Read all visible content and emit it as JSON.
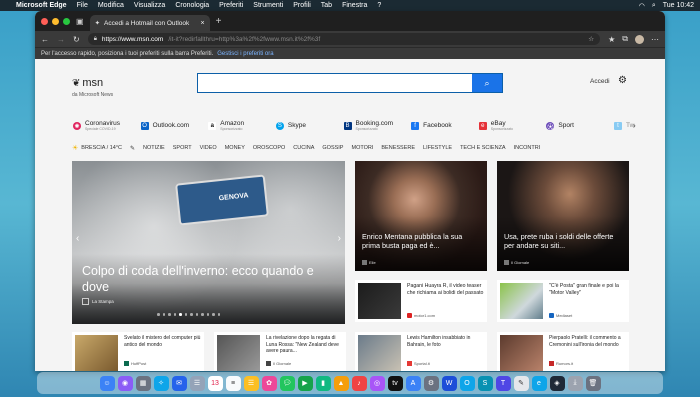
{
  "menubar": {
    "app": "Microsoft Edge",
    "items": [
      "File",
      "Modifica",
      "Visualizza",
      "Cronologia",
      "Preferiti",
      "Strumenti",
      "Profili",
      "Tab",
      "Finestra",
      "?"
    ],
    "clock": "Tue 10:42"
  },
  "browser": {
    "tab_title": "Accedi a Hotmail con Outlook",
    "url_host": "https://www.msn.com",
    "url_path": "/it-it?redirfallthru=http%3a%2f%2fwww.msn.it%2f%3f",
    "favbar_text": "Per l'accesso rapido, posiziona i tuoi preferiti sulla barra Preferiti.",
    "favbar_link": "Gestisci i preferiti ora"
  },
  "msn": {
    "logo": "msn",
    "logo_sub": "da Microsoft News",
    "search_placeholder": "",
    "signin": "Accedi"
  },
  "quicklinks": [
    {
      "label": "Coronavirus",
      "sub": "Speciale COVID-19",
      "icon": "virus-icon",
      "color": "#e0245e"
    },
    {
      "label": "Outlook.com",
      "sub": "",
      "icon": "outlook-icon",
      "color": "#0a64c8"
    },
    {
      "label": "Amazon",
      "sub": "Sponsorizzato",
      "icon": "amazon-icon",
      "color": "#111111"
    },
    {
      "label": "Skype",
      "sub": "",
      "icon": "skype-icon",
      "color": "#00a2ed"
    },
    {
      "label": "Booking.com",
      "sub": "Sponsorizzato",
      "icon": "booking-icon",
      "color": "#003580"
    },
    {
      "label": "Facebook",
      "sub": "",
      "icon": "facebook-icon",
      "color": "#1877f2"
    },
    {
      "label": "eBay",
      "sub": "Sponsorizzato",
      "icon": "ebay-icon",
      "color": "#e53238"
    },
    {
      "label": "Sport",
      "sub": "",
      "icon": "sport-icon",
      "color": "#6b4bb8"
    },
    {
      "label": "Tw",
      "sub": "",
      "icon": "twitter-icon",
      "color": "#1da1f2"
    }
  ],
  "categories": {
    "weather": "BRESCIA / 14°C",
    "items": [
      "NOTIZIE",
      "SPORT",
      "VIDEO",
      "MONEY",
      "OROSCOPO",
      "CUCINA",
      "GOSSIP",
      "MOTORI",
      "BENESSERE",
      "LIFESTYLE",
      "TECH E SCIENZA",
      "INCONTRI"
    ]
  },
  "hero": {
    "title": "Colpo di coda dell'inverno: ecco quando e dove",
    "source": "La Stampa",
    "sign": "GENOVA"
  },
  "big_cards": [
    {
      "title": "Enrico Mentana pubblica la sua prima busta paga ed è...",
      "source": "Elle"
    },
    {
      "title": "Usa, prete ruba i soldi delle offerte per andare su siti...",
      "source": "Il Giornale"
    }
  ],
  "small_cards": [
    {
      "title": "Pagani Huayra R, il video teaser che richiama ai bolidi del passato",
      "source": "motor1.com"
    },
    {
      "title": "\"C'è Posta\" gran finale e poi la \"Motor Valley\"",
      "source": "Mediaset"
    }
  ],
  "bottom_cards": [
    {
      "title": "Svelato il mistero del computer più antico del mondo",
      "source": "HuffPost"
    },
    {
      "title": "La rivelazione dopo la regata di Luna Rossa: \"New Zealand deve avere paura...",
      "source": "Il Giornale"
    },
    {
      "title": "Lewis Hamilton insabbiato in Bahrain, le foto",
      "source": "Sportal.it"
    },
    {
      "title": "Pierpaolo Pratelli: il commento a Cremonini sull'ironia del mondo",
      "source": "Rumors.it"
    }
  ]
}
